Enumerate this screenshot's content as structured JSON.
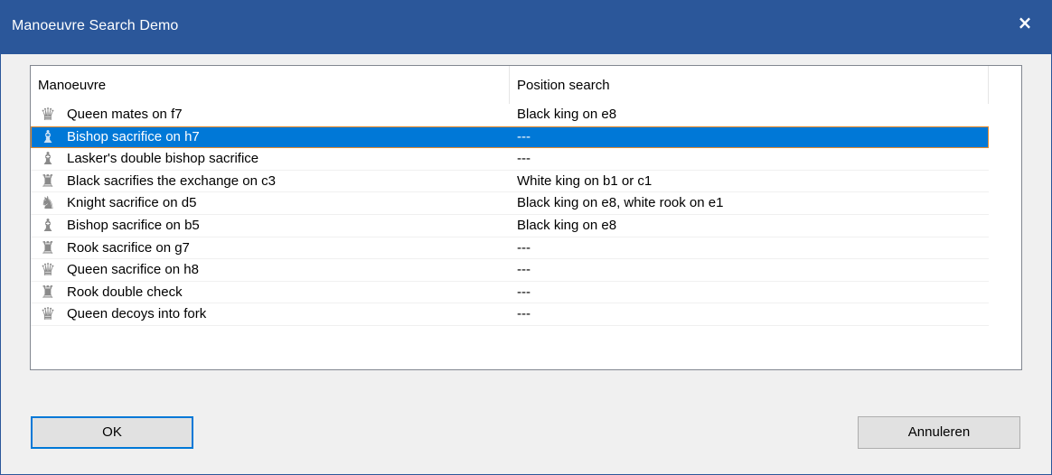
{
  "window": {
    "title": "Manoeuvre Search Demo",
    "close_glyph": "×"
  },
  "table": {
    "columns": [
      "Manoeuvre",
      "Position search"
    ],
    "selected_index": 1,
    "rows": [
      {
        "icon": "queen-icon",
        "glyph": "♛",
        "manoeuvre": "Queen mates on f7",
        "position": "Black king on e8"
      },
      {
        "icon": "bishop-icon",
        "glyph": "♝",
        "manoeuvre": "Bishop sacrifice on h7",
        "position": "---"
      },
      {
        "icon": "bishop-icon",
        "glyph": "♝",
        "manoeuvre": "Lasker's double bishop sacrifice",
        "position": "---"
      },
      {
        "icon": "rook-icon",
        "glyph": "♜",
        "manoeuvre": "Black sacrifies the exchange on c3",
        "position": "White king on b1 or c1"
      },
      {
        "icon": "knight-icon",
        "glyph": "♞",
        "manoeuvre": "Knight sacrifice on d5",
        "position": "Black king on e8, white rook on e1"
      },
      {
        "icon": "bishop-icon",
        "glyph": "♝",
        "manoeuvre": "Bishop sacrifice on b5",
        "position": "Black king on e8"
      },
      {
        "icon": "rook-icon",
        "glyph": "♜",
        "manoeuvre": "Rook sacrifice on g7",
        "position": "---"
      },
      {
        "icon": "queen-icon",
        "glyph": "♛",
        "manoeuvre": "Queen sacrifice on h8",
        "position": "---"
      },
      {
        "icon": "rook-icon",
        "glyph": "♜",
        "manoeuvre": "Rook double check",
        "position": "---"
      },
      {
        "icon": "queen-icon",
        "glyph": "♛",
        "manoeuvre": "Queen decoys into fork",
        "position": "---"
      }
    ]
  },
  "buttons": {
    "ok": "OK",
    "cancel": "Annuleren"
  },
  "colors": {
    "titlebar": "#2b579a",
    "selection": "#0078d7",
    "selection_border": "#e58a2b",
    "ok_border": "#0078d7"
  }
}
